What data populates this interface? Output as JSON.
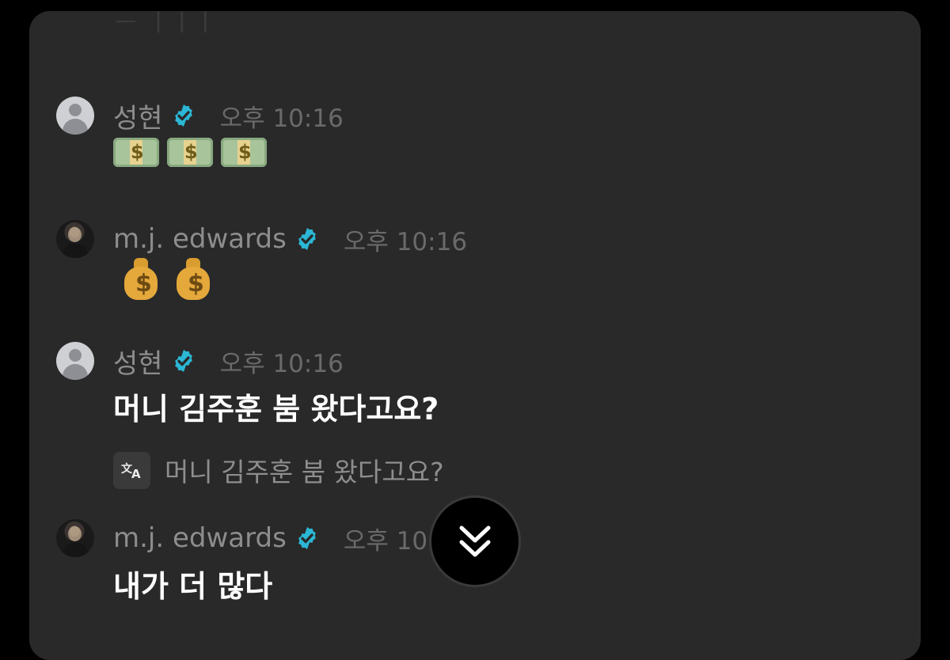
{
  "messages": [
    {
      "author": "성현",
      "time": "오후 10:16",
      "avatar": "default-avatar",
      "content_type": "emoji",
      "emojis": [
        "money-with-wings",
        "money-with-wings",
        "money-with-wings"
      ]
    },
    {
      "author": "m.j. edwards",
      "time": "오후 10:16",
      "avatar": "photo-avatar",
      "content_type": "emoji",
      "emojis": [
        "money-bag",
        "money-bag"
      ]
    },
    {
      "author": "성현",
      "time": "오후 10:16",
      "avatar": "default-avatar",
      "content_type": "text",
      "text": "머니 김주훈 붐 왔다고요?",
      "translation": "머니 김주훈 붐 왔다고요?"
    },
    {
      "author": "m.j. edwards",
      "time": "오후 10",
      "avatar": "photo-avatar",
      "content_type": "text",
      "text": "내가 더 많다"
    }
  ],
  "icons": {
    "verified": "verified-badge-icon",
    "translate": "translate-icon",
    "scroll_down": "double-chevron-down-icon"
  },
  "colors": {
    "background": "#000000",
    "panel": "#292929",
    "verified": "#2bb7d5",
    "name_text": "#8d8d8d",
    "time_text": "#6a6a6a",
    "message_text": "#ffffff"
  }
}
